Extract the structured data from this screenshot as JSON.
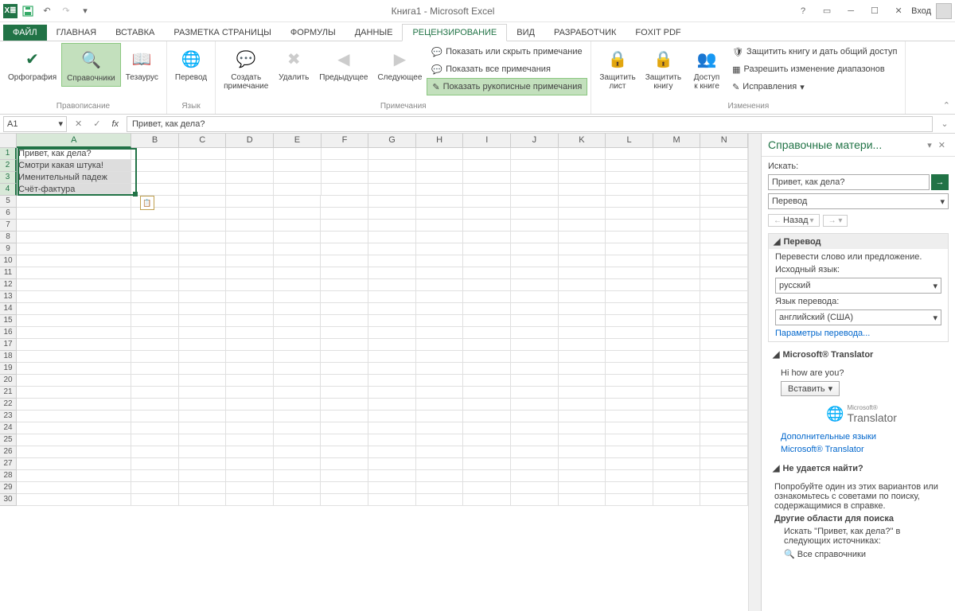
{
  "title": "Книга1 - Microsoft Excel",
  "login": "Вход",
  "tabs": {
    "file": "ФАЙЛ",
    "items": [
      "ГЛАВНАЯ",
      "ВСТАВКА",
      "РАЗМЕТКА СТРАНИЦЫ",
      "ФОРМУЛЫ",
      "ДАННЫЕ",
      "РЕЦЕНЗИРОВАНИЕ",
      "ВИД",
      "РАЗРАБОТЧИК",
      "FOXIT PDF"
    ],
    "active_index": 5
  },
  "ribbon": {
    "spelling": {
      "spellcheck": "Орфография",
      "research": "Справочники",
      "thesaurus": "Тезаурус",
      "group": "Правописание"
    },
    "language": {
      "translate": "Перевод",
      "group": "Язык"
    },
    "comments": {
      "new": "Создать\nпримечание",
      "delete": "Удалить",
      "prev": "Предыдущее",
      "next": "Следующее",
      "showhide": "Показать или скрыть примечание",
      "showall": "Показать все примечания",
      "showink": "Показать рукописные примечания",
      "group": "Примечания"
    },
    "protect": {
      "sheet": "Защитить\nлист",
      "workbook": "Защитить\nкнигу",
      "share": "Доступ\nк книге",
      "protectshare": "Защитить книгу и дать общий доступ",
      "allowranges": "Разрешить изменение диапазонов",
      "trackchanges": "Исправления",
      "group": "Изменения"
    }
  },
  "namebox": "A1",
  "formula": "Привет, как дела?",
  "columns": [
    "A",
    "B",
    "C",
    "D",
    "E",
    "F",
    "G",
    "H",
    "I",
    "J",
    "K",
    "L",
    "M",
    "N"
  ],
  "rows_count": 30,
  "cells": {
    "A1": "Привет, как дела?",
    "A2": "Смотри какая штука!",
    "A3": "Именительный падеж",
    "A4": "Счёт-фактура"
  },
  "pane": {
    "title": "Справочные матери...",
    "search_label": "Искать:",
    "search_value": "Привет, как дела?",
    "scope": "Перевод",
    "back": "Назад",
    "sec_translate": "Перевод",
    "translate_hint": "Перевести слово или предложение.",
    "src_label": "Исходный язык:",
    "src_value": "русский",
    "tgt_label": "Язык перевода:",
    "tgt_value": "английский (США)",
    "options": "Параметры перевода...",
    "ms_translator": "Microsoft® Translator",
    "result": "Hi how are you?",
    "insert": "Вставить",
    "more_langs": "Дополнительные языки",
    "ms_link": "Microsoft® Translator",
    "notfound_hdr": "Не удается найти?",
    "notfound_txt": "Попробуйте один из этих вариантов или ознакомьтесь с советами по поиску, содержащимися в справке.",
    "other_areas": "Другие области для поиска",
    "search_in": "Искать \"Привет, как дела?\" в следующих источниках:",
    "all_ref": "Все справочники"
  }
}
